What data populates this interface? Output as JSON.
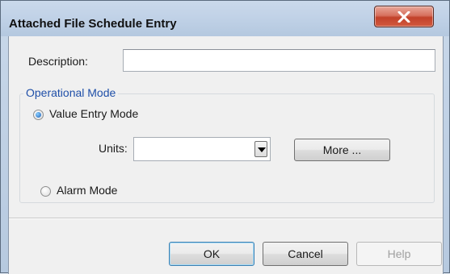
{
  "window": {
    "title": "Attached File Schedule Entry",
    "close_icon": "close-icon"
  },
  "form": {
    "description_label": "Description:",
    "description_value": "",
    "operational_mode": {
      "legend": "Operational Mode",
      "value_entry_label": "Value Entry Mode",
      "value_entry_checked": true,
      "units_label": "Units:",
      "units_value": "",
      "more_label": "More ...",
      "alarm_label": "Alarm Mode",
      "alarm_checked": false
    }
  },
  "buttons": {
    "ok": "OK",
    "cancel": "Cancel",
    "help": "Help"
  },
  "colors": {
    "accent": "#1f4fa8",
    "close_button": "#c2412a"
  }
}
